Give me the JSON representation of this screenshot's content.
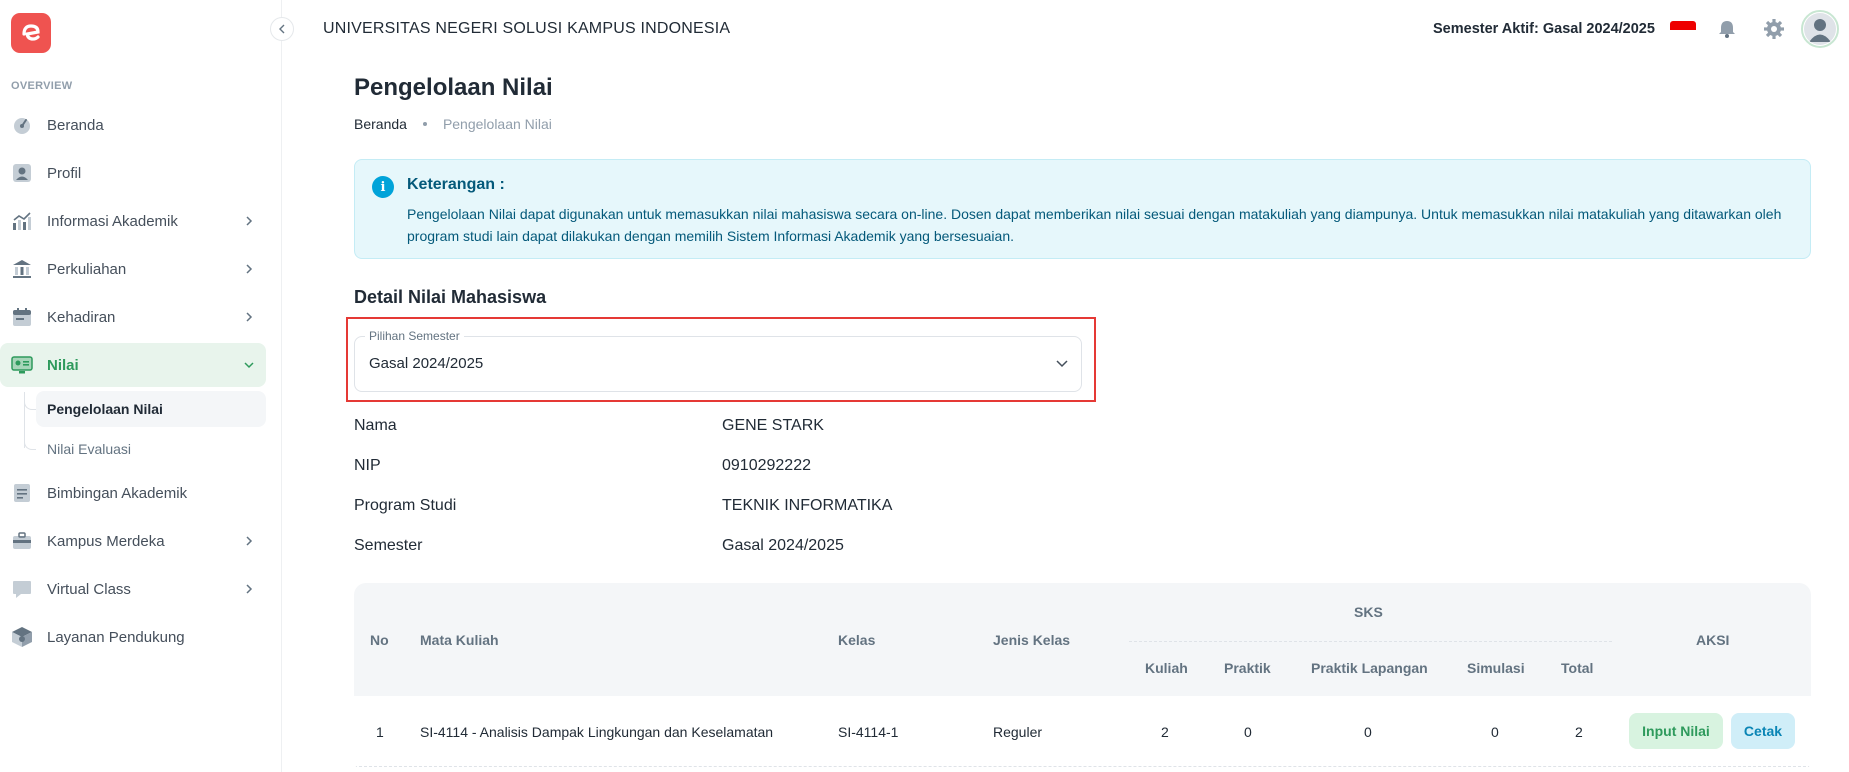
{
  "header": {
    "university": "UNIVERSITAS NEGERI SOLUSI KAMPUS INDONESIA",
    "semester_active": "Semester Aktif: Gasal 2024/2025"
  },
  "sidebar": {
    "section_label": "OVERVIEW",
    "items": [
      {
        "label": "Beranda",
        "icon": "dashboard-icon"
      },
      {
        "label": "Profil",
        "icon": "user-icon"
      },
      {
        "label": "Informasi Akademik",
        "icon": "analytics-icon"
      },
      {
        "label": "Perkuliahan",
        "icon": "building-icon"
      },
      {
        "label": "Kehadiran",
        "icon": "calendar-icon"
      },
      {
        "label": "Nilai",
        "icon": "grade-icon"
      },
      {
        "label": "Bimbingan Akademik",
        "icon": "file-icon"
      },
      {
        "label": "Kampus Merdeka",
        "icon": "briefcase-icon"
      },
      {
        "label": "Virtual Class",
        "icon": "chat-icon"
      },
      {
        "label": "Layanan Pendukung",
        "icon": "package-icon"
      }
    ],
    "sub_items": [
      {
        "label": "Pengelolaan Nilai"
      },
      {
        "label": "Nilai Evaluasi"
      }
    ]
  },
  "page": {
    "title": "Pengelolaan Nilai",
    "breadcrumb_home": "Beranda",
    "breadcrumb_current": "Pengelolaan Nilai"
  },
  "alert": {
    "title": "Keterangan :",
    "text": "Pengelolaan Nilai dapat digunakan untuk memasukkan nilai mahasiswa secara on-line. Dosen dapat memberikan nilai sesuai dengan matakuliah yang diampunya. Untuk memasukkan nilai matakuliah yang ditawarkan oleh program studi lain dapat dilakukan dengan memilih Sistem Informasi Akademik yang bersesuaian."
  },
  "detail": {
    "section_title": "Detail Nilai Mahasiswa",
    "semester_select_label": "Pilihan Semester",
    "semester_select_value": "Gasal 2024/2025",
    "fields": [
      {
        "label": "Nama",
        "value": "GENE STARK"
      },
      {
        "label": "NIP",
        "value": "0910292222"
      },
      {
        "label": "Program Studi",
        "value": "TEKNIK INFORMATIKA"
      },
      {
        "label": "Semester",
        "value": "Gasal 2024/2025"
      }
    ]
  },
  "table": {
    "headers": {
      "no": "No",
      "mata_kuliah": "Mata Kuliah",
      "kelas": "Kelas",
      "jenis_kelas": "Jenis Kelas",
      "sks": "SKS",
      "kuliah": "Kuliah",
      "praktik": "Praktik",
      "praktik_lapangan": "Praktik Lapangan",
      "simulasi": "Simulasi",
      "total": "Total",
      "aksi": "AKSI"
    },
    "rows": [
      {
        "no": "1",
        "mata_kuliah": "SI-4114 - Analisis Dampak Lingkungan dan Keselamatan",
        "kelas": "SI-4114-1",
        "jenis_kelas": "Reguler",
        "kuliah": "2",
        "praktik": "0",
        "praktik_lapangan": "0",
        "simulasi": "0",
        "total": "2",
        "btn_input": "Input Nilai",
        "btn_cetak": "Cetak"
      }
    ]
  },
  "colors": {
    "brand": "#ef5350",
    "active_green": "#2e9a5c",
    "alert_blue": "#04597a",
    "highlight_red": "#e53935"
  }
}
